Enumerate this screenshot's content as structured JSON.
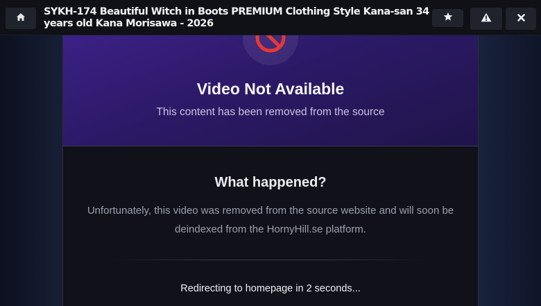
{
  "topbar": {
    "title": "SYKH-174 Beautiful Witch in Boots PREMIUM Clothing Style Kana-san 34 years old Kana Morisawa - 2026",
    "icons": {
      "home": "home-icon",
      "star": "star-icon",
      "report": "warning-icon",
      "close": "close-icon"
    }
  },
  "notice": {
    "icon": "no-entry-icon",
    "title": "Video Not Available",
    "subtitle": "This content has been removed from the source"
  },
  "details": {
    "heading": "What happened?",
    "body": "Unfortunately, this video was removed from the source website and will soon be deindexed from the HornyHill.se platform.",
    "redirect": "Redirecting to homepage in 2 seconds..."
  },
  "colors": {
    "accent": "#3b2186",
    "icon_red": "#e53935",
    "background": "#111119"
  }
}
